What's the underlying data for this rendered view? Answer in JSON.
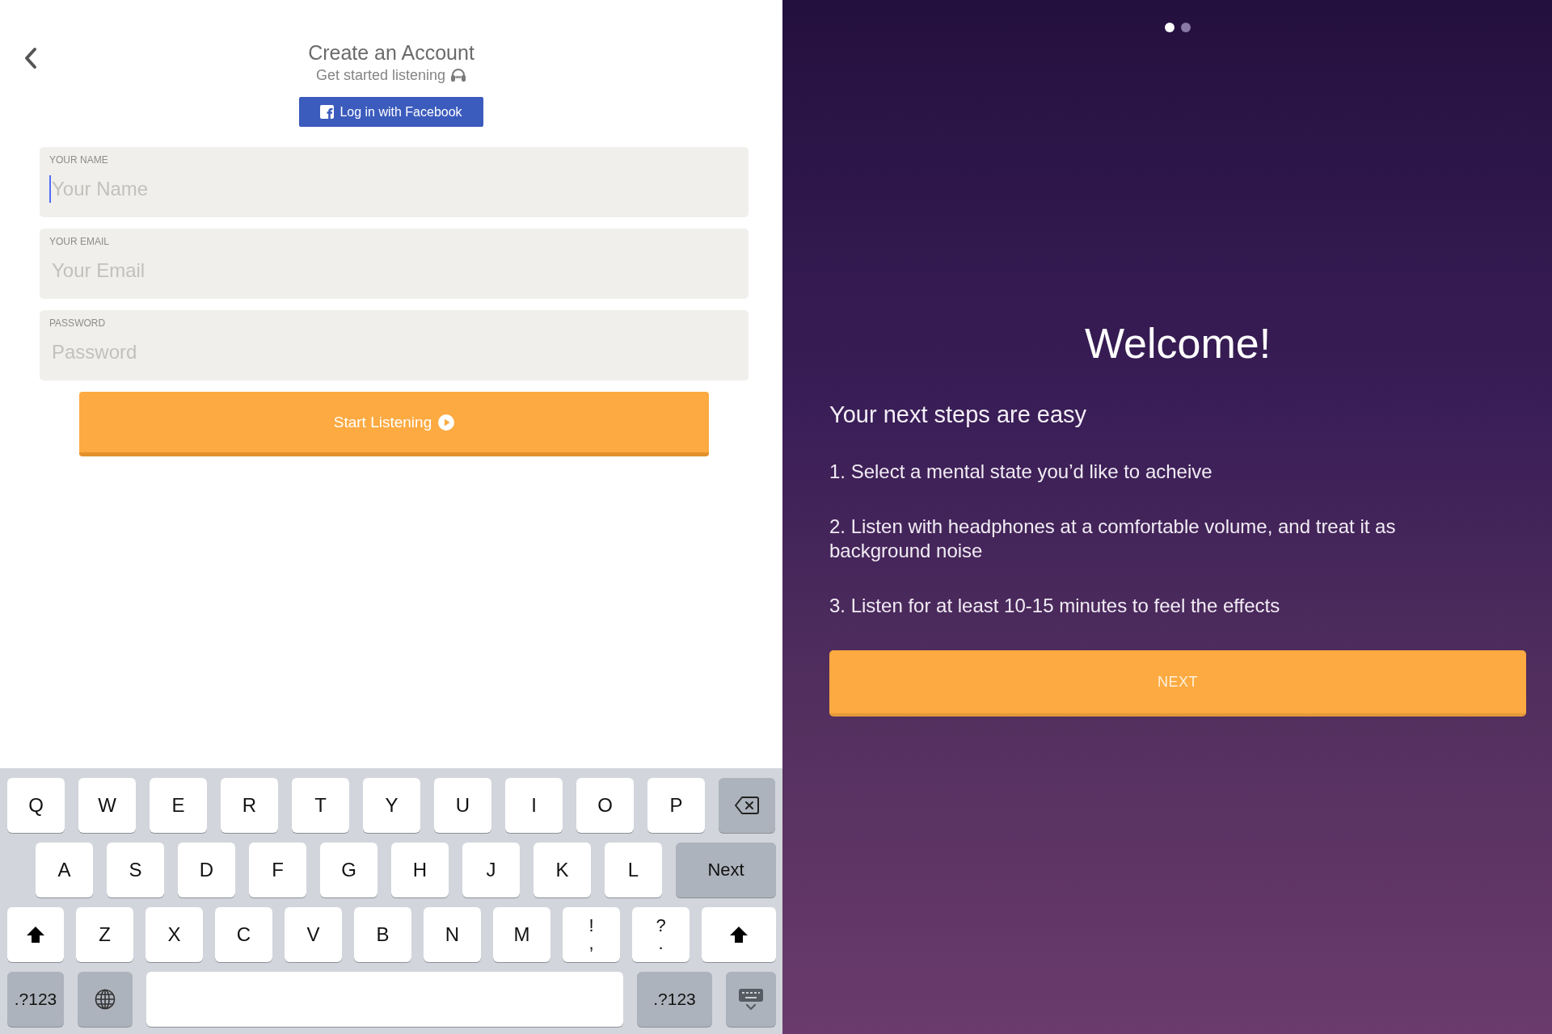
{
  "signup": {
    "title": "Create an Account",
    "subtitle": "Get started listening",
    "facebook_button": "Log in with Facebook",
    "fields": [
      {
        "label": "YOUR NAME",
        "placeholder": "Your Name",
        "focused": true
      },
      {
        "label": "YOUR EMAIL",
        "placeholder": "Your Email",
        "focused": false
      },
      {
        "label": "PASSWORD",
        "placeholder": "Password",
        "focused": false
      }
    ],
    "submit_button": "Start Listening"
  },
  "keyboard": {
    "rows": [
      {
        "keys": [
          {
            "kind": "letter",
            "label": "Q"
          },
          {
            "kind": "letter",
            "label": "W"
          },
          {
            "kind": "letter",
            "label": "E"
          },
          {
            "kind": "letter",
            "label": "R"
          },
          {
            "kind": "letter",
            "label": "T"
          },
          {
            "kind": "letter",
            "label": "Y"
          },
          {
            "kind": "letter",
            "label": "U"
          },
          {
            "kind": "letter",
            "label": "I"
          },
          {
            "kind": "letter",
            "label": "O"
          },
          {
            "kind": "letter",
            "label": "P"
          },
          {
            "kind": "backspace"
          }
        ]
      },
      {
        "keys": [
          {
            "kind": "letter",
            "label": "A"
          },
          {
            "kind": "letter",
            "label": "S"
          },
          {
            "kind": "letter",
            "label": "D"
          },
          {
            "kind": "letter",
            "label": "F"
          },
          {
            "kind": "letter",
            "label": "G"
          },
          {
            "kind": "letter",
            "label": "H"
          },
          {
            "kind": "letter",
            "label": "J"
          },
          {
            "kind": "letter",
            "label": "K"
          },
          {
            "kind": "letter",
            "label": "L"
          },
          {
            "kind": "return",
            "label": "Next"
          }
        ]
      },
      {
        "keys": [
          {
            "kind": "shift"
          },
          {
            "kind": "letter",
            "label": "Z"
          },
          {
            "kind": "letter",
            "label": "X"
          },
          {
            "kind": "letter",
            "label": "C"
          },
          {
            "kind": "letter",
            "label": "V"
          },
          {
            "kind": "letter",
            "label": "B"
          },
          {
            "kind": "letter",
            "label": "N"
          },
          {
            "kind": "letter",
            "label": "M"
          },
          {
            "kind": "dual",
            "label": "!",
            "sublabel": ","
          },
          {
            "kind": "dual",
            "label": "?",
            "sublabel": "."
          },
          {
            "kind": "shift"
          }
        ]
      },
      {
        "keys": [
          {
            "kind": "mode",
            "label": ".?123"
          },
          {
            "kind": "globe"
          },
          {
            "kind": "space"
          },
          {
            "kind": "mode",
            "label": ".?123"
          },
          {
            "kind": "dismiss"
          }
        ]
      }
    ]
  },
  "welcome": {
    "page_dots": [
      {
        "selected": true
      },
      {
        "selected": false
      }
    ],
    "title": "Welcome!",
    "subtitle": "Your next steps are easy",
    "steps": [
      "1. Select a mental state you’d like to acheive",
      "2. Listen with headphones at a comfortable volume, and treat it as background noise",
      "3. Listen for at least 10-15 minutes to feel the effects"
    ],
    "next_button": "NEXT"
  }
}
